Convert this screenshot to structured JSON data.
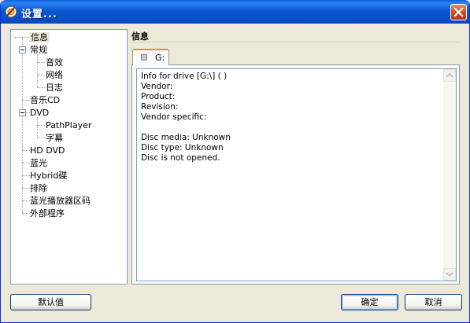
{
  "window": {
    "title": "设置..."
  },
  "tree": {
    "items": [
      {
        "label": "信息"
      },
      {
        "label": "常规"
      },
      {
        "label": "音效"
      },
      {
        "label": "网络"
      },
      {
        "label": "日志"
      },
      {
        "label": "音乐CD"
      },
      {
        "label": "DVD"
      },
      {
        "label": "PathPlayer"
      },
      {
        "label": "字幕"
      },
      {
        "label": "HD DVD"
      },
      {
        "label": "蓝光"
      },
      {
        "label": "Hybrid碟"
      },
      {
        "label": "排除"
      },
      {
        "label": "蓝光播放器区码"
      },
      {
        "label": "外部程序"
      }
    ],
    "selected": "信息"
  },
  "section": {
    "title": "信息"
  },
  "tabs": [
    {
      "label": "G:"
    }
  ],
  "info": {
    "lines": [
      "Info for drive [G:\\] ( )",
      "Vendor:",
      "Product:",
      "Revision:",
      "Vendor specific:",
      "",
      "Disc media: Unknown",
      "Disc type: Unknown",
      "Disc is not opened."
    ]
  },
  "buttons": {
    "defaults": "默认值",
    "ok": "确定",
    "cancel": "取消"
  },
  "colors": {
    "titlebar": "#0A5FD8",
    "close": "#D0431B",
    "tab_accent": "#E68B2C"
  }
}
